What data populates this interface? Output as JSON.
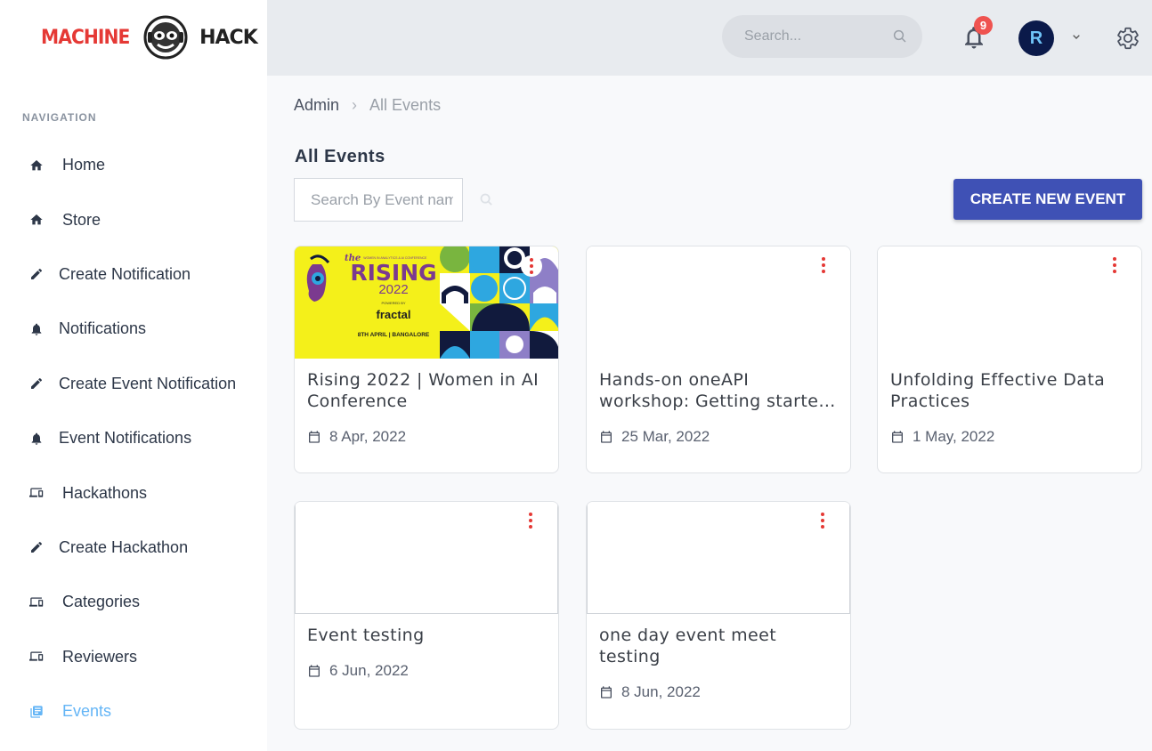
{
  "logo": {
    "word_left": "MACHINE",
    "word_right": "HACK"
  },
  "sidebar": {
    "heading": "NAVIGATION",
    "items": [
      {
        "label": "Home",
        "icon": "home-icon"
      },
      {
        "label": "Store",
        "icon": "home-icon"
      },
      {
        "label": "Create Notification",
        "icon": "pencil-icon"
      },
      {
        "label": "Notifications",
        "icon": "bell-icon"
      },
      {
        "label": "Create Event Notification",
        "icon": "pencil-icon"
      },
      {
        "label": "Event Notifications",
        "icon": "bell-icon"
      },
      {
        "label": "Hackathons",
        "icon": "monitor-icon"
      },
      {
        "label": "Create Hackathon",
        "icon": "pencil-icon"
      },
      {
        "label": "Categories",
        "icon": "monitor-icon"
      },
      {
        "label": "Reviewers",
        "icon": "monitor-icon"
      },
      {
        "label": "Events",
        "icon": "list-icon",
        "active": true
      }
    ]
  },
  "topbar": {
    "search_placeholder": "Search...",
    "notification_count": "9",
    "avatar_initial": "R"
  },
  "breadcrumb": {
    "root": "Admin",
    "current": "All Events"
  },
  "page": {
    "title": "All Events",
    "search_placeholder": "Search By Event name",
    "create_button": "CREATE NEW EVENT"
  },
  "events": [
    {
      "title_line1": "Rising 2022 | Women in AI",
      "title_line2": "Conference",
      "date": "8 Apr, 2022",
      "banner": {
        "the": "the",
        "tagline": "WOMEN IN ANALYTICS & AI CONFERENCE",
        "name": "RISING",
        "year": "2022",
        "powered": "POWERED BY",
        "sponsor": "fractal",
        "footer": "8TH APRIL | BANGALORE"
      }
    },
    {
      "title_line1": "Hands-on oneAPI",
      "title_line2": "workshop: Getting started with...",
      "date": "25 Mar, 2022"
    },
    {
      "title_line1": "Unfolding Effective Data",
      "title_line2": "Practices",
      "date": "1 May, 2022"
    },
    {
      "title_line1": "Event testing",
      "title_line2": "",
      "date": "6 Jun, 2022"
    },
    {
      "title_line1": "one day event meet",
      "title_line2": "testing",
      "date": "8 Jun, 2022"
    }
  ],
  "colors": {
    "accent": "#3f51b5",
    "active_nav": "#64b5f6",
    "badge": "#ef5350",
    "menu_dots": "#e53935"
  }
}
